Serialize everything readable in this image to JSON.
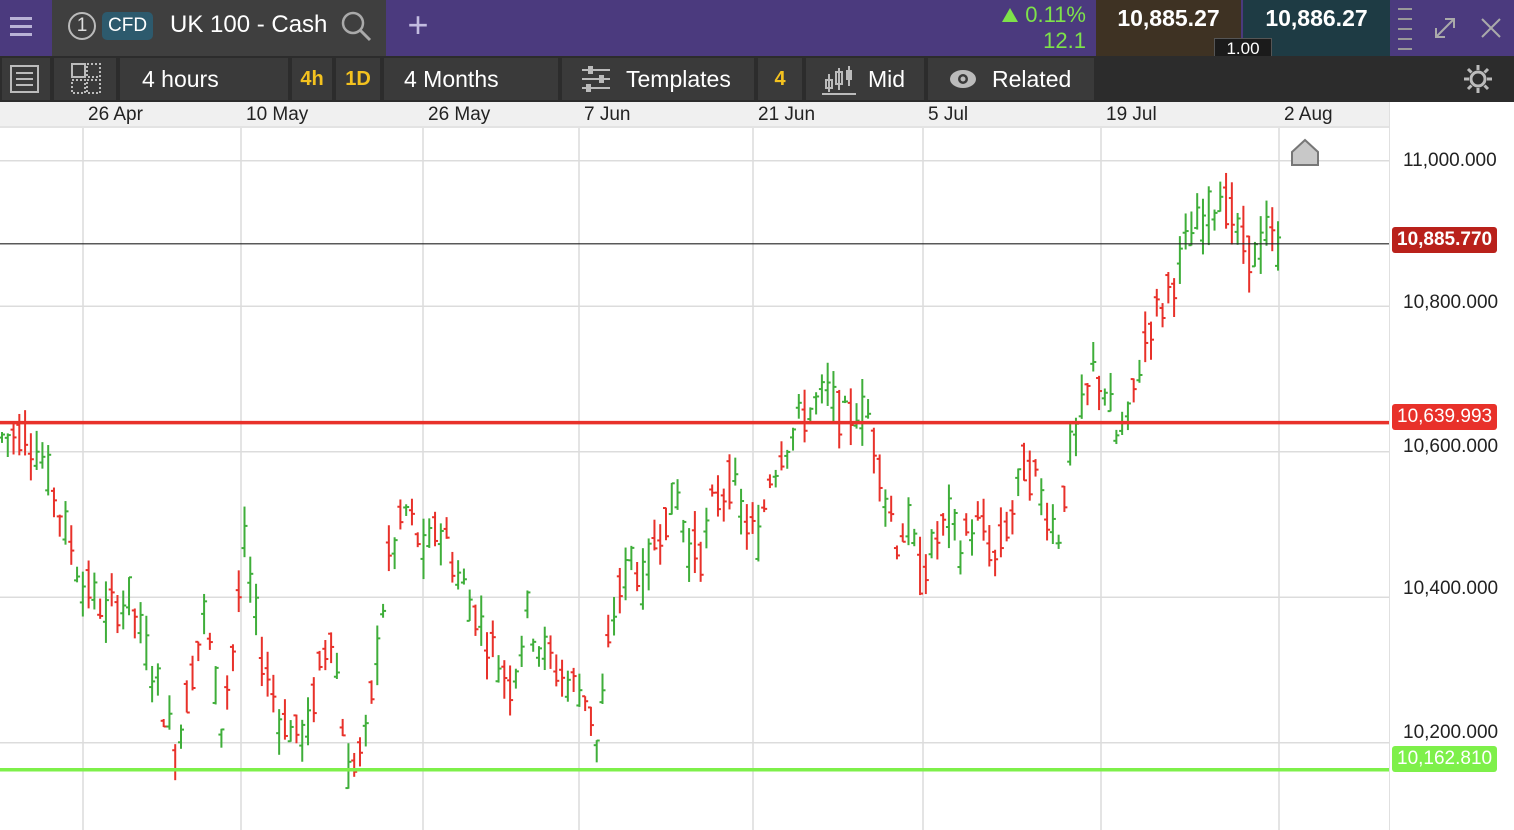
{
  "header": {
    "instrument_index": "1",
    "instrument_type": "CFD",
    "instrument_name": "UK 100 - Cash",
    "add_label": "+",
    "change_pct": "0.11%",
    "change_points": "12.1",
    "sell_price": "10,885.27",
    "buy_price": "10,886.27",
    "spread": "1.00",
    "colors": {
      "bar": "#4b3a7e",
      "up": "#7ee24a",
      "sell_bg": "#3e3223",
      "buy_bg": "#1e3b44"
    }
  },
  "toolbar": {
    "interval_label": "4 hours",
    "quick_interval_1": "4h",
    "quick_interval_2": "1D",
    "range_label": "4 Months",
    "templates_label": "Templates",
    "templates_count": "4",
    "price_type_label": "Mid",
    "related_label": "Related"
  },
  "icons": [
    "menu-icon",
    "search-icon",
    "plus-icon",
    "drag-handle-icon",
    "expand-icon",
    "close-icon",
    "list-icon",
    "layout-icon",
    "sliders-icon",
    "candles-icon",
    "eye-icon",
    "gear-icon",
    "home-marker-icon"
  ],
  "chart_data": {
    "type": "candlestick",
    "x_ticks": [
      "26 Apr",
      "10 May",
      "26 May",
      "7 Jun",
      "21 Jun",
      "5 Jul",
      "19 Jul",
      "2 Aug"
    ],
    "y_ticks": [
      "11,000.000",
      "10,800.000",
      "10,600.000",
      "10,400.000",
      "10,200.000"
    ],
    "y_tick_values": [
      11000,
      10800,
      10600,
      10400,
      10200
    ],
    "ylim": [
      10080,
      11045
    ],
    "current_price": {
      "label": "10,885.770",
      "value": 10885.77,
      "color": "#b9211b"
    },
    "resistance_line": {
      "label": "10,639.993",
      "value": 10639.993,
      "color": "#e8312a"
    },
    "support_line": {
      "label": "10,162.810",
      "value": 10162.81,
      "color": "#7ef04a"
    },
    "up_color": "#3fae3a",
    "down_color": "#e8312a",
    "close_path": [
      [
        0,
        10620
      ],
      [
        4,
        10630
      ],
      [
        7,
        10590
      ],
      [
        10,
        10520
      ],
      [
        14,
        10420
      ],
      [
        18,
        10380
      ],
      [
        22,
        10400
      ],
      [
        25,
        10330
      ],
      [
        27,
        10280
      ],
      [
        30,
        10190
      ],
      [
        33,
        10300
      ],
      [
        35,
        10380
      ],
      [
        38,
        10230
      ],
      [
        40,
        10330
      ],
      [
        42,
        10470
      ],
      [
        45,
        10320
      ],
      [
        48,
        10240
      ],
      [
        51,
        10210
      ],
      [
        53,
        10220
      ],
      [
        55,
        10300
      ],
      [
        57,
        10360
      ],
      [
        60,
        10160
      ],
      [
        63,
        10200
      ],
      [
        65,
        10330
      ],
      [
        67,
        10450
      ],
      [
        70,
        10520
      ],
      [
        73,
        10460
      ],
      [
        76,
        10500
      ],
      [
        78,
        10450
      ],
      [
        82,
        10380
      ],
      [
        85,
        10330
      ],
      [
        88,
        10280
      ],
      [
        91,
        10380
      ],
      [
        93,
        10340
      ],
      [
        96,
        10300
      ],
      [
        99,
        10280
      ],
      [
        101,
        10270
      ],
      [
        103,
        10200
      ],
      [
        106,
        10380
      ],
      [
        109,
        10460
      ],
      [
        111,
        10420
      ],
      [
        114,
        10500
      ],
      [
        117,
        10540
      ],
      [
        119,
        10470
      ],
      [
        121,
        10460
      ],
      [
        123,
        10520
      ],
      [
        126,
        10560
      ],
      [
        129,
        10500
      ],
      [
        131,
        10480
      ],
      [
        133,
        10570
      ],
      [
        136,
        10620
      ],
      [
        140,
        10660
      ],
      [
        143,
        10680
      ],
      [
        146,
        10640
      ],
      [
        148,
        10660
      ],
      [
        150,
        10650
      ],
      [
        152,
        10580
      ],
      [
        155,
        10480
      ],
      [
        157,
        10500
      ],
      [
        159,
        10430
      ],
      [
        162,
        10480
      ],
      [
        164,
        10510
      ],
      [
        166,
        10470
      ],
      [
        168,
        10500
      ],
      [
        170,
        10490
      ],
      [
        172,
        10450
      ],
      [
        175,
        10520
      ],
      [
        177,
        10580
      ],
      [
        179,
        10560
      ],
      [
        181,
        10520
      ],
      [
        183,
        10490
      ],
      [
        185,
        10600
      ],
      [
        187,
        10650
      ],
      [
        189,
        10710
      ],
      [
        191,
        10690
      ],
      [
        193,
        10620
      ],
      [
        195,
        10640
      ],
      [
        197,
        10720
      ],
      [
        199,
        10780
      ],
      [
        201,
        10800
      ],
      [
        203,
        10840
      ],
      [
        206,
        10900
      ],
      [
        209,
        10930
      ],
      [
        211,
        10960
      ],
      [
        213,
        10920
      ],
      [
        215,
        10880
      ],
      [
        217,
        10870
      ],
      [
        219,
        10900
      ],
      [
        221,
        10880
      ]
    ]
  }
}
